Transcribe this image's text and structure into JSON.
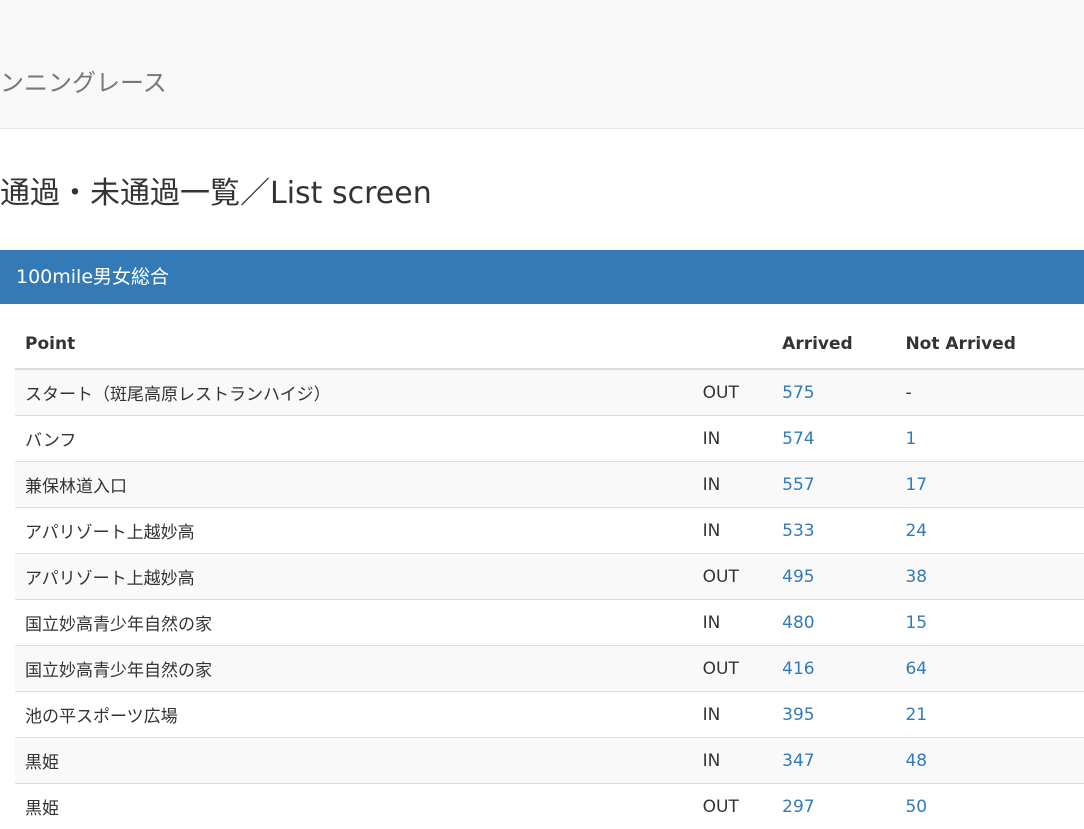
{
  "navbar": {
    "brand": "ンニングレース"
  },
  "page": {
    "title": "通過・未通過一覧／List screen"
  },
  "panel": {
    "title": "100mile男女総合"
  },
  "table": {
    "headers": {
      "point": "Point",
      "direction": "",
      "arrived": "Arrived",
      "not_arrived": "Not Arrived"
    },
    "rows": [
      {
        "point": "スタート（斑尾高原レストランハイジ）",
        "direction": "OUT",
        "arrived": "575",
        "not_arrived": "-"
      },
      {
        "point": "バンフ",
        "direction": "IN",
        "arrived": "574",
        "not_arrived": "1"
      },
      {
        "point": "兼保林道入口",
        "direction": "IN",
        "arrived": "557",
        "not_arrived": "17"
      },
      {
        "point": "アパリゾート上越妙高",
        "direction": "IN",
        "arrived": "533",
        "not_arrived": "24"
      },
      {
        "point": "アパリゾート上越妙高",
        "direction": "OUT",
        "arrived": "495",
        "not_arrived": "38"
      },
      {
        "point": "国立妙高青少年自然の家",
        "direction": "IN",
        "arrived": "480",
        "not_arrived": "15"
      },
      {
        "point": "国立妙高青少年自然の家",
        "direction": "OUT",
        "arrived": "416",
        "not_arrived": "64"
      },
      {
        "point": "池の平スポーツ広場",
        "direction": "IN",
        "arrived": "395",
        "not_arrived": "21"
      },
      {
        "point": "黒姫",
        "direction": "IN",
        "arrived": "347",
        "not_arrived": "48"
      },
      {
        "point": "黒姫",
        "direction": "OUT",
        "arrived": "297",
        "not_arrived": "50"
      }
    ]
  }
}
